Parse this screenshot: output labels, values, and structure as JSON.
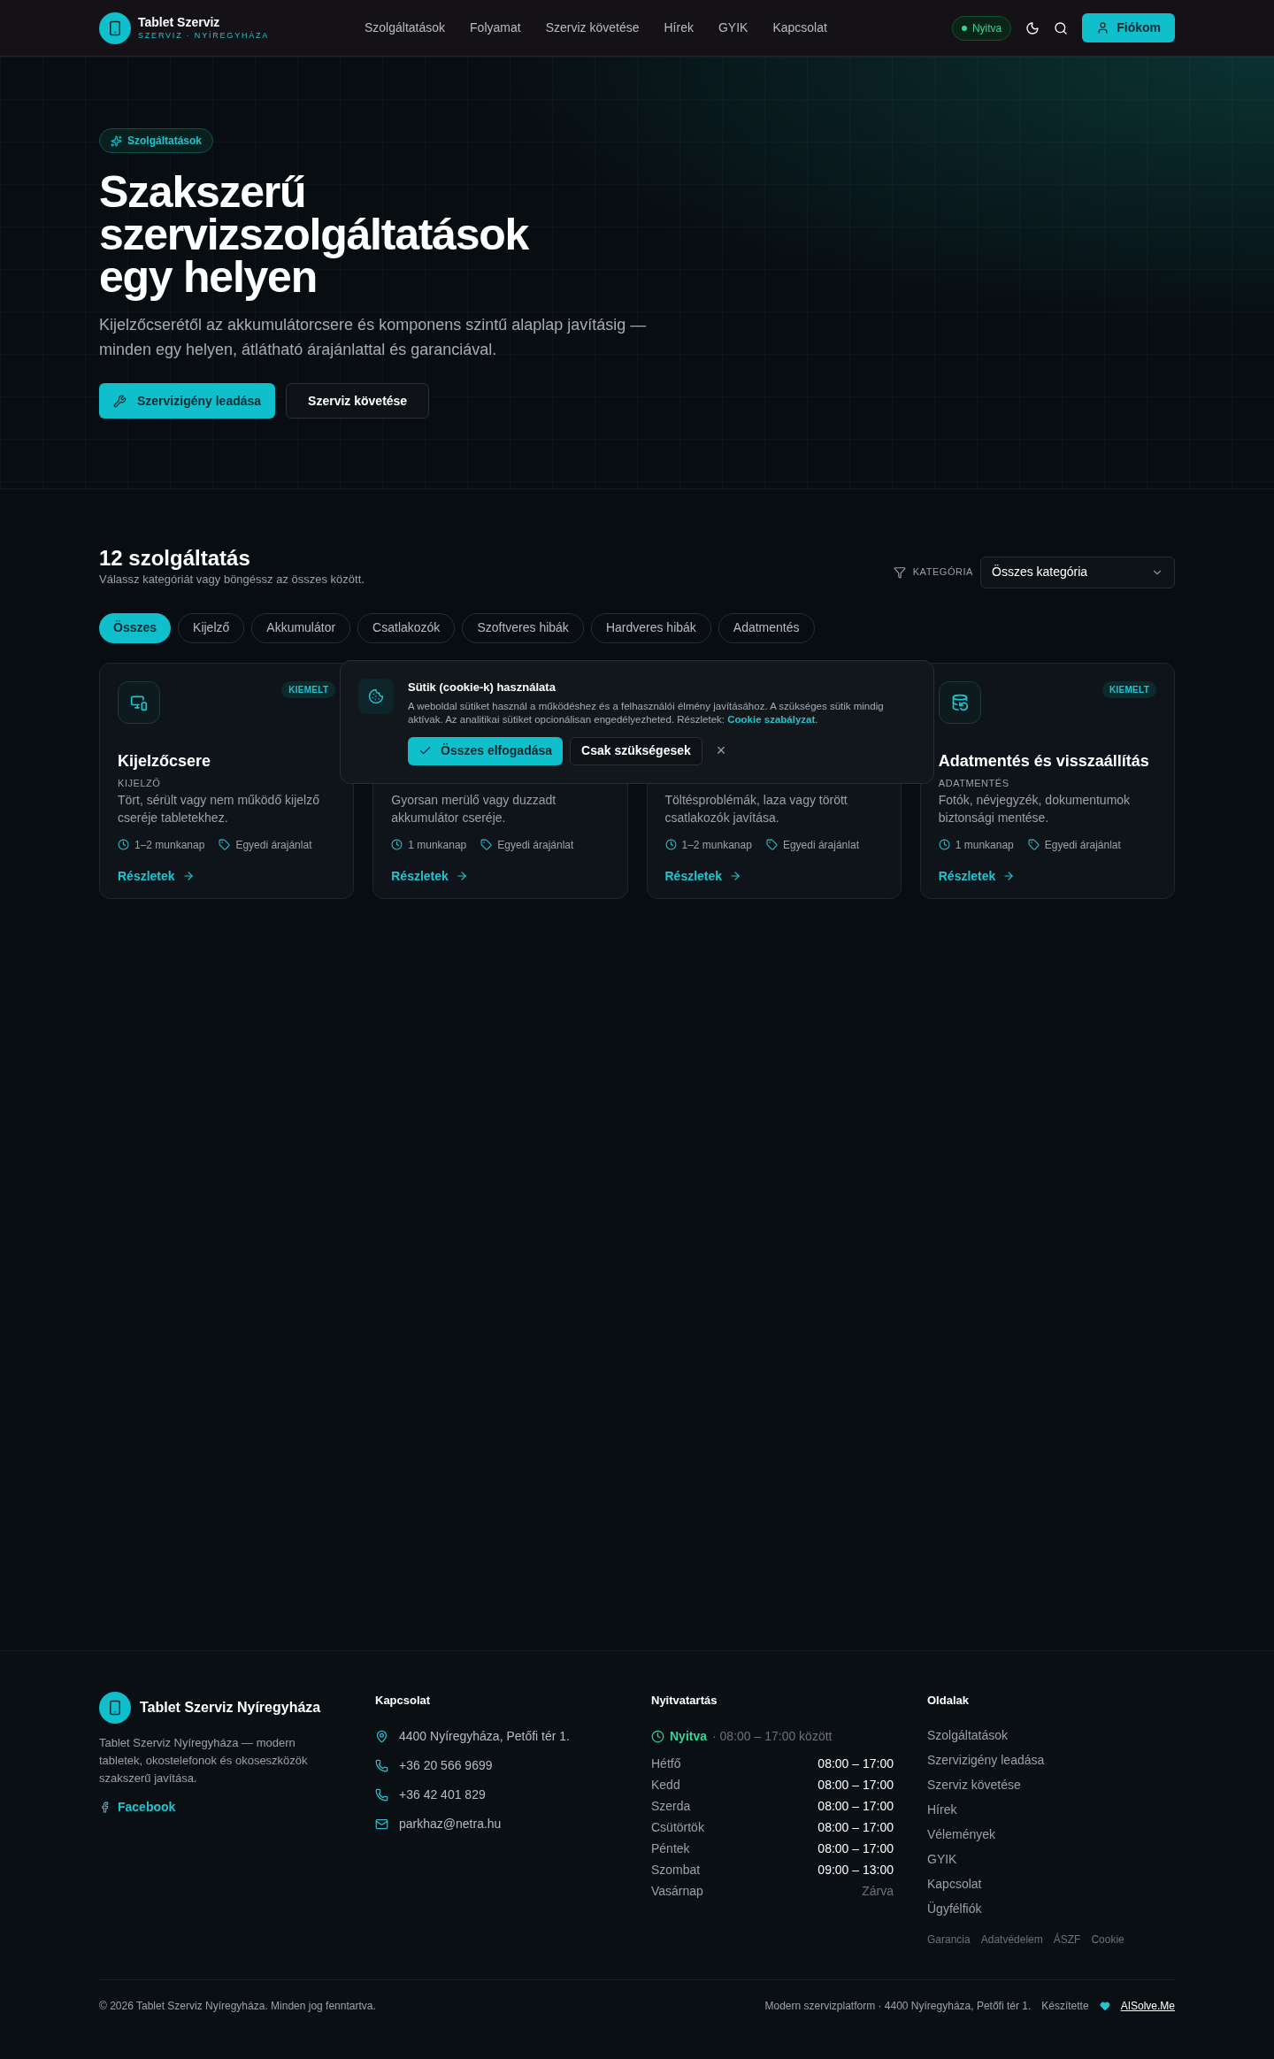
{
  "header": {
    "brand": {
      "name": "Tablet Szerviz",
      "tagline": "SZERVIZ · NYÍREGYHÁZA"
    },
    "nav": [
      {
        "label": "Szolgáltatások"
      },
      {
        "label": "Folyamat"
      },
      {
        "label": "Szerviz követése"
      },
      {
        "label": "Hírek"
      },
      {
        "label": "GYIK"
      },
      {
        "label": "Kapcsolat"
      }
    ],
    "status": {
      "label": "Nyitva",
      "open": true
    },
    "account_button": "Fiókom"
  },
  "hero": {
    "badge": "Szolgáltatások",
    "title_lines": [
      "Szakszerű",
      "szervizszolgáltatások",
      "egy helyen"
    ],
    "subtitle": "Kijelzőcserétől az akkumulátorcsere és komponens szintű alaplap javításig — minden egy helyen, átlátható árajánlattal és garanciával.",
    "primary_button": "Szervizigény leadása",
    "secondary_button": "Szerviz követése"
  },
  "services": {
    "title": "12 szolgáltatás",
    "subtitle": "Válassz kategóriát vagy böngéssz az összes között.",
    "category_filter": {
      "label": "KATEGÓRIA",
      "value": "Összes kategória"
    },
    "chips": [
      {
        "label": "Összes",
        "selected": true
      },
      {
        "label": "Kijelző",
        "selected": false
      },
      {
        "label": "Akkumulátor",
        "selected": false
      },
      {
        "label": "Csatlakozók",
        "selected": false
      },
      {
        "label": "Szoftveres hibák",
        "selected": false
      },
      {
        "label": "Hardveres hibák",
        "selected": false
      },
      {
        "label": "Adatmentés",
        "selected": false
      }
    ],
    "cards": [
      {
        "badge": "KIEMELT",
        "title": "Kijelzőcsere",
        "category": "KIJELZŐ",
        "description": "Tört, sérült vagy nem működő kijelző cseréje tabletekhez.",
        "duration": "1–2 munkanap",
        "price": "Egyedi árajánlat",
        "link": "Részletek"
      },
      {
        "description": "Gyorsan merülő vagy duzzadt akkumulátor cseréje.",
        "duration": "1 munkanap",
        "price": "Egyedi árajánlat",
        "link": "Részletek"
      },
      {
        "description": "Töltésproblémák, laza vagy törött csatlakozók javítása.",
        "duration": "1–2 munkanap",
        "price": "Egyedi árajánlat",
        "link": "Részletek"
      },
      {
        "badge": "KIEMELT",
        "title": "Adatmentés és visszaállítás",
        "category": "ADATMENTÉS",
        "description": "Fotók, névjegyzék, dokumentumok biztonsági mentése.",
        "duration": "1 munkanap",
        "price": "Egyedi árajánlat",
        "link": "Részletek"
      }
    ]
  },
  "cookie_banner": {
    "title": "Sütik (cookie-k) használata",
    "text": "A weboldal sütiket használ a működéshez és a felhasználói élmény javításához. A szükséges sütik mindig aktívak. Az analitikai sütiket opcionálisan engedélyezheted. Részletek:",
    "link": "Cookie szabályzat",
    "after_link": ".",
    "accept_button": "Összes elfogadása",
    "necessary_button": "Csak szükségesek",
    "close_label": "×"
  },
  "footer": {
    "brand": {
      "name": "Tablet Szerviz Nyíregyháza",
      "description": "Tablet Szerviz Nyíregyháza — modern tabletek, okostelefonok és okoseszközök szakszerű javítása.",
      "social": "Facebook"
    },
    "contact": {
      "title": "Kapcsolat",
      "items": [
        {
          "kind": "address",
          "text": "4400 Nyíregyháza, Petőfi tér 1."
        },
        {
          "kind": "phone",
          "text": "+36 20 566 9699"
        },
        {
          "kind": "phone",
          "text": "+36 42 401 829"
        },
        {
          "kind": "email",
          "text": "parkhaz@netra.hu"
        }
      ]
    },
    "hours": {
      "title": "Nyitvatartás",
      "status": "Nyitva",
      "status_detail": "· 08:00 – 17:00 között",
      "days": [
        {
          "day": "Hétfő",
          "time": "08:00 – 17:00",
          "closed": false
        },
        {
          "day": "Kedd",
          "time": "08:00 – 17:00",
          "closed": false
        },
        {
          "day": "Szerda",
          "time": "08:00 – 17:00",
          "closed": false
        },
        {
          "day": "Csütörtök",
          "time": "08:00 – 17:00",
          "closed": false
        },
        {
          "day": "Péntek",
          "time": "08:00 – 17:00",
          "closed": false
        },
        {
          "day": "Szombat",
          "time": "09:00 – 13:00",
          "closed": false
        },
        {
          "day": "Vasárnap",
          "time": "Zárva",
          "closed": true
        }
      ]
    },
    "pages": {
      "title": "Oldalak",
      "links": [
        "Szolgáltatások",
        "Szervizigény leadása",
        "Szerviz követése",
        "Hírek",
        "Vélemények",
        "GYIK",
        "Kapcsolat",
        "Ügyfélfiók"
      ],
      "legal": [
        "Garancia",
        "Adatvédelem",
        "ÁSZF",
        "Cookie"
      ]
    },
    "copyright": "© 2026 Tablet Szerviz Nyíregyháza. Minden jog fenntartva.",
    "platform": "Modern szervizplatform · 4400 Nyíregyháza, Petőfi tér 1.",
    "made_by": "Készítette",
    "maker": "AISolve.Me"
  }
}
